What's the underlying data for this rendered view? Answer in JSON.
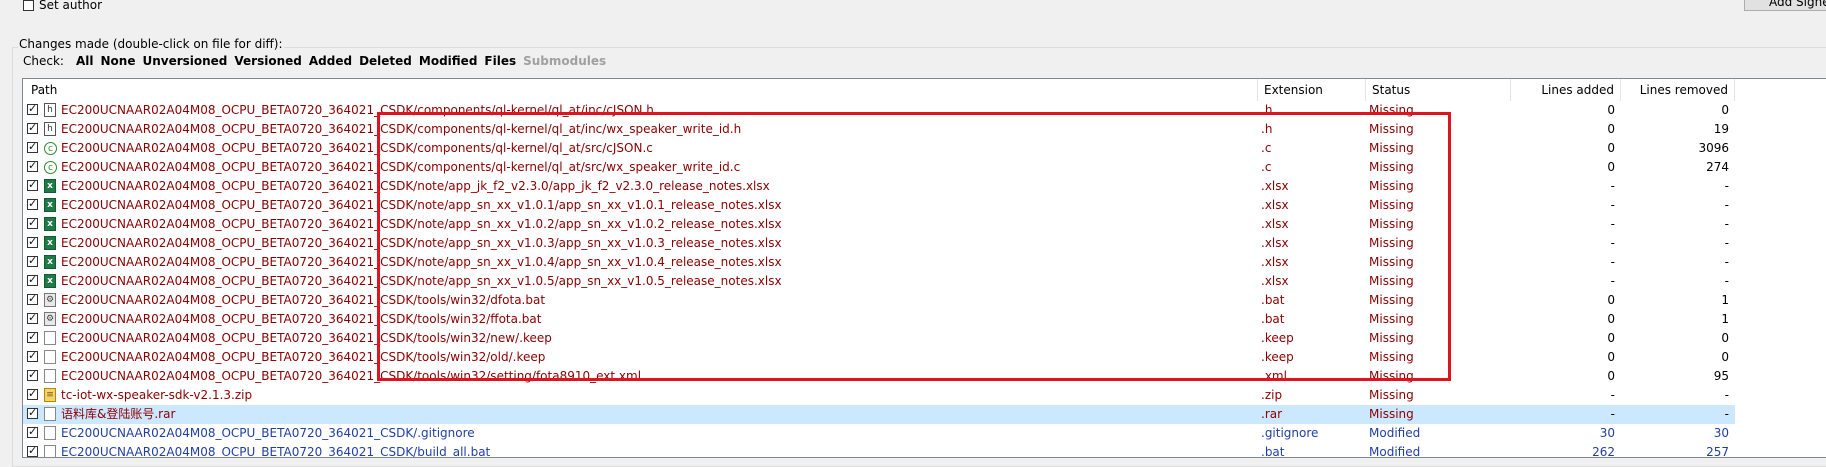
{
  "top": {
    "set_author_label": "Set author",
    "add_signed_label": "Add Signed"
  },
  "changes": {
    "group_title": "Changes made (double-click on file for diff):",
    "check_label": "Check:",
    "filters": [
      "All",
      "None",
      "Unversioned",
      "Versioned",
      "Added",
      "Deleted",
      "Modified",
      "Files"
    ],
    "filter_disabled": "Submodules"
  },
  "columns": {
    "path": "Path",
    "extension": "Extension",
    "status": "Status",
    "lines_added": "Lines added",
    "lines_removed": "Lines removed"
  },
  "rows": [
    {
      "icon": "h-file-icon",
      "path": "EC200UCNAAR02A04M08_OCPU_BETA0720_364021_CSDK/components/ql-kernel/ql_at/inc/cJSON.h",
      "ext": ".h",
      "status": "Missing",
      "added": "0",
      "removed": "0"
    },
    {
      "icon": "h-file-icon",
      "path": "EC200UCNAAR02A04M08_OCPU_BETA0720_364021_CSDK/components/ql-kernel/ql_at/inc/wx_speaker_write_id.h",
      "ext": ".h",
      "status": "Missing",
      "added": "0",
      "removed": "19"
    },
    {
      "icon": "c-file-icon",
      "path": "EC200UCNAAR02A04M08_OCPU_BETA0720_364021_CSDK/components/ql-kernel/ql_at/src/cJSON.c",
      "ext": ".c",
      "status": "Missing",
      "added": "0",
      "removed": "3096"
    },
    {
      "icon": "c-file-icon",
      "path": "EC200UCNAAR02A04M08_OCPU_BETA0720_364021_CSDK/components/ql-kernel/ql_at/src/wx_speaker_write_id.c",
      "ext": ".c",
      "status": "Missing",
      "added": "0",
      "removed": "274"
    },
    {
      "icon": "excel-file-icon",
      "path": "EC200UCNAAR02A04M08_OCPU_BETA0720_364021_CSDK/note/app_jk_f2_v2.3.0/app_jk_f2_v2.3.0_release_notes.xlsx",
      "ext": ".xlsx",
      "status": "Missing",
      "added": "-",
      "removed": "-"
    },
    {
      "icon": "excel-file-icon",
      "path": "EC200UCNAAR02A04M08_OCPU_BETA0720_364021_CSDK/note/app_sn_xx_v1.0.1/app_sn_xx_v1.0.1_release_notes.xlsx",
      "ext": ".xlsx",
      "status": "Missing",
      "added": "-",
      "removed": "-"
    },
    {
      "icon": "excel-file-icon",
      "path": "EC200UCNAAR02A04M08_OCPU_BETA0720_364021_CSDK/note/app_sn_xx_v1.0.2/app_sn_xx_v1.0.2_release_notes.xlsx",
      "ext": ".xlsx",
      "status": "Missing",
      "added": "-",
      "removed": "-"
    },
    {
      "icon": "excel-file-icon",
      "path": "EC200UCNAAR02A04M08_OCPU_BETA0720_364021_CSDK/note/app_sn_xx_v1.0.3/app_sn_xx_v1.0.3_release_notes.xlsx",
      "ext": ".xlsx",
      "status": "Missing",
      "added": "-",
      "removed": "-"
    },
    {
      "icon": "excel-file-icon",
      "path": "EC200UCNAAR02A04M08_OCPU_BETA0720_364021_CSDK/note/app_sn_xx_v1.0.4/app_sn_xx_v1.0.4_release_notes.xlsx",
      "ext": ".xlsx",
      "status": "Missing",
      "added": "-",
      "removed": "-"
    },
    {
      "icon": "excel-file-icon",
      "path": "EC200UCNAAR02A04M08_OCPU_BETA0720_364021_CSDK/note/app_sn_xx_v1.0.5/app_sn_xx_v1.0.5_release_notes.xlsx",
      "ext": ".xlsx",
      "status": "Missing",
      "added": "-",
      "removed": "-"
    },
    {
      "icon": "bat-file-icon",
      "path": "EC200UCNAAR02A04M08_OCPU_BETA0720_364021_CSDK/tools/win32/dfota.bat",
      "ext": ".bat",
      "status": "Missing",
      "added": "0",
      "removed": "1"
    },
    {
      "icon": "bat-file-icon",
      "path": "EC200UCNAAR02A04M08_OCPU_BETA0720_364021_CSDK/tools/win32/ffota.bat",
      "ext": ".bat",
      "status": "Missing",
      "added": "0",
      "removed": "1"
    },
    {
      "icon": "blank-file-icon",
      "path": "EC200UCNAAR02A04M08_OCPU_BETA0720_364021_CSDK/tools/win32/new/.keep",
      "ext": ".keep",
      "status": "Missing",
      "added": "0",
      "removed": "0"
    },
    {
      "icon": "blank-file-icon",
      "path": "EC200UCNAAR02A04M08_OCPU_BETA0720_364021_CSDK/tools/win32/old/.keep",
      "ext": ".keep",
      "status": "Missing",
      "added": "0",
      "removed": "0"
    },
    {
      "icon": "blank-file-icon",
      "path": "EC200UCNAAR02A04M08_OCPU_BETA0720_364021_CSDK/tools/win32/setting/fota8910_ext.xml",
      "ext": ".xml",
      "status": "Missing",
      "added": "0",
      "removed": "95"
    },
    {
      "icon": "zip-file-icon",
      "path": "tc-iot-wx-speaker-sdk-v2.1.3.zip",
      "ext": ".zip",
      "status": "Missing",
      "added": "-",
      "removed": "-"
    },
    {
      "icon": "blank-file-icon",
      "path": "语料库&登陆账号.rar",
      "ext": ".rar",
      "status": "Missing",
      "added": "-",
      "removed": "-",
      "selected": true
    },
    {
      "icon": "blank-file-icon",
      "path": "EC200UCNAAR02A04M08_OCPU_BETA0720_364021_CSDK/.gitignore",
      "ext": ".gitignore",
      "status": "Modified",
      "added": "30",
      "removed": "30",
      "modified": true
    },
    {
      "icon": "blank-file-icon",
      "path": "EC200UCNAAR02A04M08_OCPU_BETA0720_364021_CSDK/build_all.bat",
      "ext": ".bat",
      "status": "Modified",
      "added": "262",
      "removed": "257",
      "modified": true
    }
  ],
  "colors": {
    "missing_text": "#8b0000",
    "modified_text": "#1f3fa6",
    "selection": "#cce8ff",
    "annotation_box": "#e0141e"
  }
}
